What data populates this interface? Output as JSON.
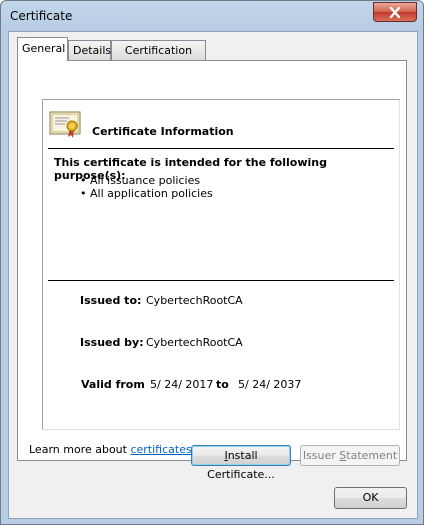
{
  "window": {
    "title": "Certificate"
  },
  "tabs": [
    {
      "label": "General"
    },
    {
      "label": "Details"
    },
    {
      "label": "Certification Path"
    }
  ],
  "cert": {
    "heading": "Certificate Information",
    "purpose_heading": "This certificate is intended for the following purpose(s):",
    "purposes": [
      "All issuance policies",
      "All application policies"
    ],
    "issued_to_label": "Issued to:",
    "issued_to_value": "CybertechRootCA",
    "issued_by_label": "Issued by:",
    "issued_by_value": "CybertechRootCA",
    "valid_from_label": "Valid from",
    "valid_from_value": "5/ 24/ 2017",
    "valid_to_label": "to",
    "valid_to_value": "5/ 24/ 2037"
  },
  "buttons": {
    "install_pre": "I",
    "install_rest": "nstall Certificate...",
    "issuer_pre": "Issuer ",
    "issuer_u": "S",
    "issuer_rest": "tatement",
    "ok": "OK"
  },
  "learn_more": {
    "text": "Learn more about ",
    "link": "certificates"
  },
  "icons": {
    "close": "close-icon",
    "certificate": "certificate-icon"
  }
}
